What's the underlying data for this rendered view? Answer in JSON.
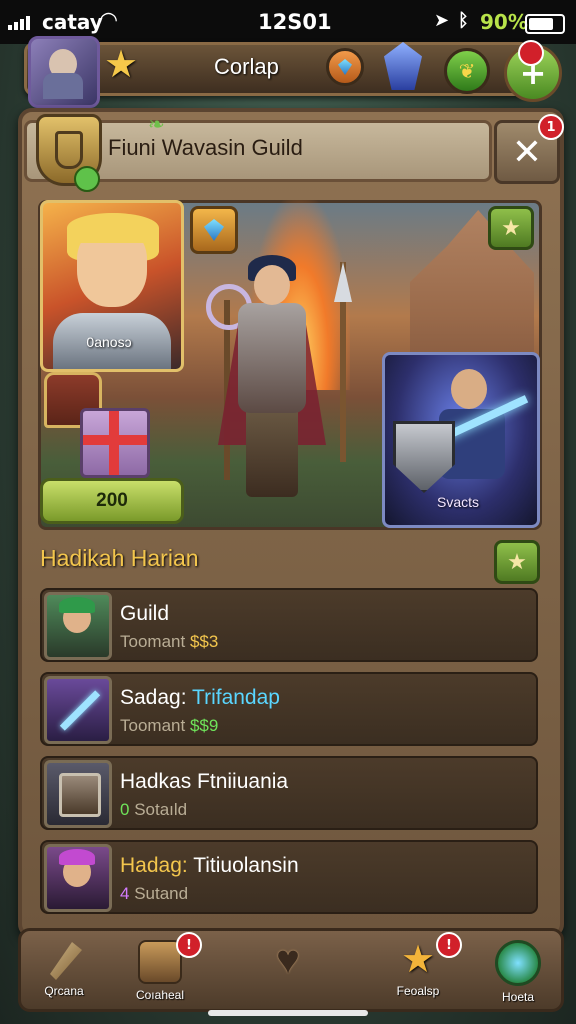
{
  "status_bar": {
    "carrier": "catay",
    "time": "12S01",
    "battery": "90%"
  },
  "top_bar": {
    "title": "Corlap"
  },
  "guild_header": {
    "title": "Fiuni Wavasin Guild",
    "close_symbol": "✕",
    "close_badge": "1"
  },
  "hero_scene": {
    "left_caption": "0anosɔ",
    "right_caption": "Svacts",
    "reward_count": "200"
  },
  "section": {
    "title": "Hadikah Harian",
    "star_symbol": "★"
  },
  "rows": [
    {
      "title": "Guild",
      "sub_label": "Toomant",
      "sub_value": "$$3"
    },
    {
      "title_prefix": "Sadag:",
      "title_value": "Trifandap",
      "sub_label": "Toomant",
      "sub_value": "$$9"
    },
    {
      "title": "Hadkas Ftniiuania",
      "sub_value": "0",
      "sub_label": "Sotaıld"
    },
    {
      "title_prefix": "Hadag:",
      "title_value": "Titiuolansin",
      "sub_value": "4",
      "sub_label": "Sutand"
    }
  ],
  "bottom_nav": [
    {
      "label": "Qrcana",
      "icon": "sword-icon"
    },
    {
      "label": "Coıaheal",
      "icon": "chest-icon",
      "badge": "!"
    },
    {
      "label": "",
      "icon": "heart-icon"
    },
    {
      "label": "Feoalsp",
      "icon": "star-icon",
      "badge": "!"
    },
    {
      "label": "Hoeta",
      "icon": "crystal-icon"
    }
  ],
  "colors": {
    "accent_gold": "#f3c64d",
    "accent_cyan": "#5ad6ff",
    "accent_green": "#6fe35a",
    "panel_wood": "#8f7252"
  }
}
